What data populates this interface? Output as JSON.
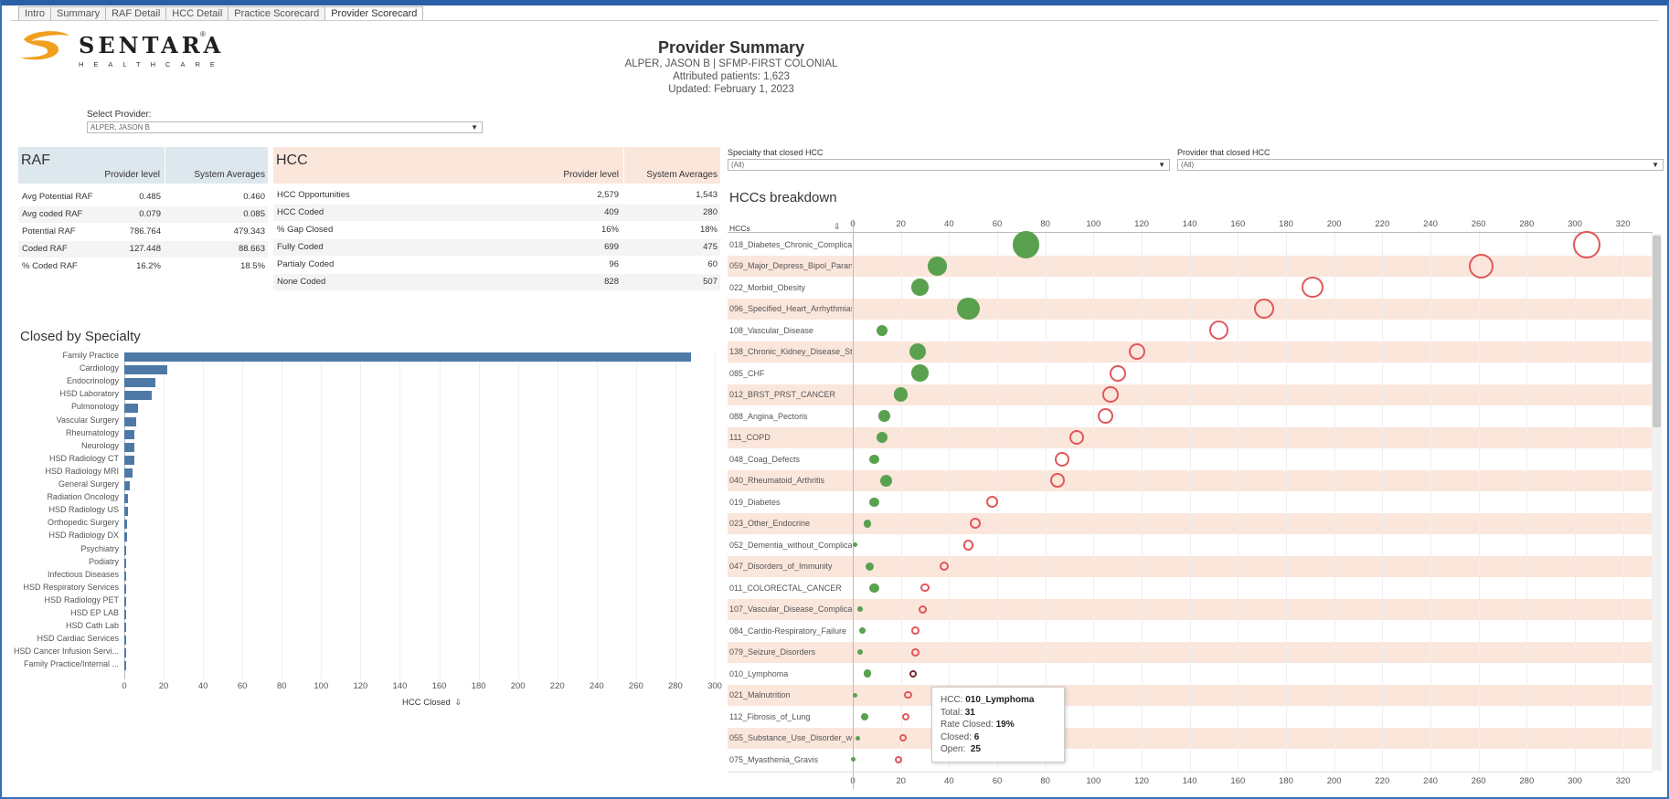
{
  "tabs": [
    "Intro",
    "Summary",
    "RAF Detail",
    "HCC Detail",
    "Practice Scorecard",
    "Provider Scorecard"
  ],
  "active_tab": "Provider Scorecard",
  "logo": {
    "word": "SENTARA",
    "sub": "HEALTHCARE",
    "reg": "®"
  },
  "header": {
    "title": "Provider Summary",
    "provider_line": "ALPER, JASON B | SFMP-FIRST COLONIAL",
    "attributed": "Attributed patients: 1,623",
    "updated": "Updated: February 1, 2023"
  },
  "select_provider": {
    "label": "Select Provider:",
    "value": "ALPER, JASON B"
  },
  "filters": {
    "specialty": {
      "label": "Specialty that closed HCC",
      "value": "(All)"
    },
    "provider": {
      "label": "Provider that closed HCC",
      "value": "(All)"
    }
  },
  "raf": {
    "title": "RAF",
    "col1": "Provider level",
    "col2": "System Averages",
    "rows": [
      {
        "label": "Avg Potential RAF",
        "p": "0.485",
        "s": "0.460"
      },
      {
        "label": "Avg coded RAF",
        "p": "0.079",
        "s": "0.085"
      },
      {
        "label": "Potential RAF",
        "p": "786.764",
        "s": "479.343"
      },
      {
        "label": "Coded RAF",
        "p": "127.448",
        "s": "88.663"
      },
      {
        "label": "% Coded RAF",
        "p": "16.2%",
        "s": "18.5%"
      }
    ]
  },
  "hcc": {
    "title": "HCC",
    "col1": "Provider level",
    "col2": "System Averages",
    "rows": [
      {
        "label": "HCC Opportunities",
        "p": "2,579",
        "s": "1,543"
      },
      {
        "label": "HCC Coded",
        "p": "409",
        "s": "280"
      },
      {
        "label": "% Gap Closed",
        "p": "16%",
        "s": "18%"
      },
      {
        "label": "Fully Coded",
        "p": "699",
        "s": "475"
      },
      {
        "label": "Partialy Coded",
        "p": "96",
        "s": "60"
      },
      {
        "label": "None Coded",
        "p": "828",
        "s": "507"
      }
    ]
  },
  "closed_by_specialty": {
    "title": "Closed by Specialty",
    "xlabel": "HCC Closed",
    "ticks": [
      "0",
      "20",
      "40",
      "60",
      "80",
      "100",
      "120",
      "140",
      "160",
      "180",
      "200",
      "220",
      "240",
      "260",
      "280",
      "300"
    ],
    "bar_color": "#4e79a7"
  },
  "hccs_breakdown": {
    "title": "HCCs breakdown",
    "col_label": "HCCs",
    "ticks": [
      "0",
      "20",
      "40",
      "60",
      "80",
      "100",
      "120",
      "140",
      "160",
      "180",
      "200",
      "220",
      "240",
      "260",
      "280",
      "300",
      "320"
    ],
    "closed_color": "#59a14f",
    "open_color": "#e15759",
    "row_alt_color": "#fbe6dc"
  },
  "tooltip": {
    "hcc_label": "HCC:",
    "hcc": "010_Lymphoma",
    "total_label": "Total:",
    "total": "31",
    "rate_label": "Rate Closed:",
    "rate": "19%",
    "closed_label": "Closed:",
    "closed": "6",
    "open_label": "Open:",
    "open": "25"
  },
  "chart_data": [
    {
      "type": "bar",
      "title": "Closed by Specialty",
      "xlabel": "HCC Closed",
      "categories": [
        "Family Practice",
        "Cardiology",
        "Endocrinology",
        "HSD Laboratory",
        "Pulmonology",
        "Vascular Surgery",
        "Rheumatology",
        "Neurology",
        "HSD Radiology CT",
        "HSD Radiology MRI",
        "General Surgery",
        "Radiation Oncology",
        "HSD Radiology US",
        "Orthopedic Surgery",
        "HSD Radiology DX",
        "Psychiatry",
        "Podiatry",
        "Infectious Diseases",
        "HSD Respiratory Services",
        "HSD Radiology PET",
        "HSD EP LAB",
        "HSD Cath Lab",
        "HSD Cardiac Services",
        "HSD Cancer Infusion Servi...",
        "Family Practice/Internal ..."
      ],
      "values": [
        288,
        22,
        16,
        14,
        7,
        6,
        5,
        5,
        5,
        4,
        3,
        2,
        2,
        1.5,
        1.5,
        1,
        1,
        1,
        1,
        1,
        1,
        1,
        1,
        1,
        1
      ],
      "xlim": [
        0,
        300
      ]
    },
    {
      "type": "scatter",
      "title": "HCCs breakdown",
      "categories": [
        "018_Diabetes_Chronic_Complicat",
        "059_Major_Depress_Bipol_Parano",
        "022_Morbid_Obesity",
        "096_Specified_Heart_Arrhythmias",
        "108_Vascular_Disease",
        "138_Chronic_Kidney_Disease_Stag",
        "085_CHF",
        "012_BRST_PRST_CANCER",
        "088_Angina_Pectoris",
        "111_COPD",
        "048_Coag_Defects",
        "040_Rheumatoid_Arthritis",
        "019_Diabetes",
        "023_Other_Endocrine",
        "052_Dementia_without_Complicat",
        "047_Disorders_of_Immunity",
        "011_COLORECTAL_CANCER",
        "107_Vascular_Disease_Complicat",
        "084_Cardio-Respiratory_Failure",
        "079_Seizure_Disorders",
        "010_Lymphoma",
        "021_Malnutrition",
        "112_Fibrosis_of_Lung",
        "055_Substance_Use_Disorder_wi",
        "075_Myasthenia_Gravis"
      ],
      "series": [
        {
          "name": "Closed",
          "values": [
            72,
            35,
            28,
            48,
            12,
            27,
            28,
            20,
            13,
            12,
            9,
            14,
            9,
            6,
            1,
            7,
            9,
            3,
            4,
            3,
            6,
            1,
            5,
            2,
            0
          ]
        },
        {
          "name": "Open",
          "values": [
            305,
            261,
            191,
            171,
            152,
            118,
            110,
            107,
            105,
            93,
            87,
            85,
            58,
            51,
            48,
            38,
            30,
            29,
            26,
            26,
            25,
            23,
            22,
            21,
            19
          ]
        }
      ],
      "xlim": [
        0,
        330
      ]
    }
  ]
}
